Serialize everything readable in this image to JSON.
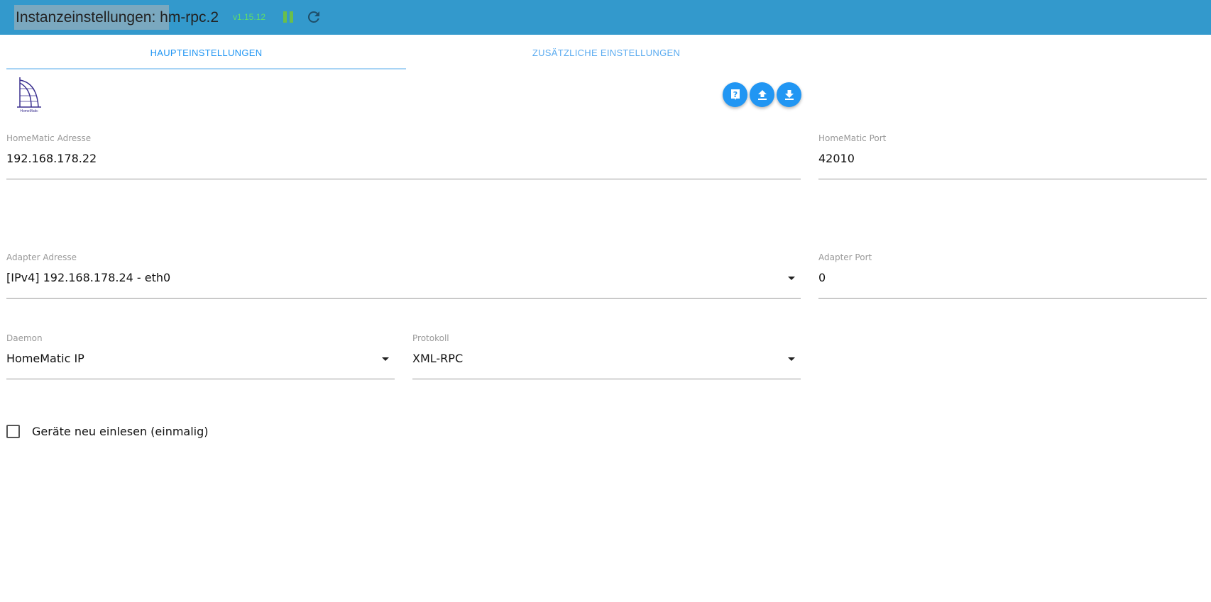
{
  "header": {
    "title": "Instanzeinstellungen: hm-rpc.2",
    "version": "v1.15.12",
    "pause_icon": "pause-icon",
    "reload_icon": "reload-icon"
  },
  "tabs": [
    {
      "label": "HAUPTEINSTELLUNGEN",
      "active": true
    },
    {
      "label": "ZUSÄTZLICHE EINSTELLUNGEN",
      "active": false
    }
  ],
  "logo": {
    "text": "HomeMatic"
  },
  "actions": [
    "help-icon",
    "upload-icon",
    "download-icon"
  ],
  "fields": {
    "hm_address": {
      "label": "HomeMatic Adresse",
      "value": "192.168.178.22"
    },
    "hm_port": {
      "label": "HomeMatic Port",
      "value": "42010"
    },
    "adapter_address": {
      "label": "Adapter Adresse",
      "value": "[IPv4] 192.168.178.24 - eth0"
    },
    "adapter_port": {
      "label": "Adapter Port",
      "value": "0"
    },
    "daemon": {
      "label": "Daemon",
      "value": "HomeMatic IP"
    },
    "protocol": {
      "label": "Protokoll",
      "value": "XML-RPC"
    }
  },
  "checkbox": {
    "label": "Geräte neu einlesen (einmalig)",
    "checked": false
  },
  "colors": {
    "header": "#3399cc",
    "accent": "#2196f3",
    "version": "#5fdc6a"
  }
}
